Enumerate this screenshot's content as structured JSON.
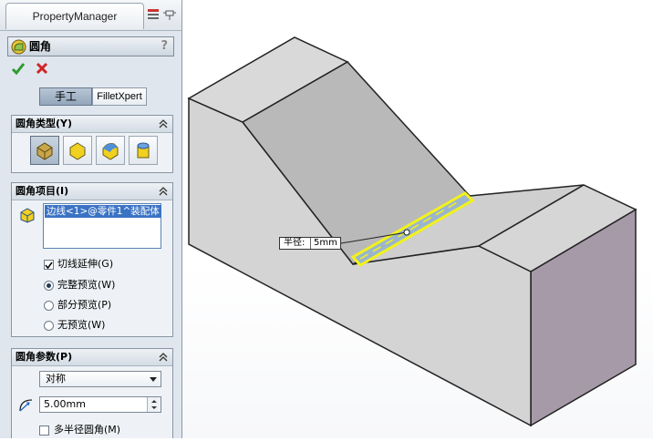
{
  "property_manager": {
    "tab_title": "PropertyManager",
    "feature": {
      "title": "圆角",
      "help": "?"
    },
    "mode_tabs": [
      "手工",
      "FilletXpert"
    ],
    "groups": {
      "fillet_type": {
        "title": "圆角类型(Y)"
      },
      "items": {
        "title": "圆角项目(I)",
        "selected_edge": "边线<1>@零件1^装配体",
        "tangent_propagation": "切线延伸(G)",
        "preview_options": [
          "完整预览(W)",
          "部分预览(P)",
          "无预览(W)"
        ],
        "selected_preview": "完整预览(W)"
      },
      "params": {
        "title": "圆角参数(P)",
        "method": "对称",
        "radius": "5.00mm",
        "multi_radius": "多半径圆角(M)"
      }
    }
  },
  "viewport": {
    "callout_label": "半径:",
    "callout_value": "5mm"
  },
  "colors": {
    "panel_bg": "#dfe6ee",
    "selection_blue": "#3b73c4",
    "highlight_yellow": "#f2f21a",
    "model_face": "#d3d3d3"
  }
}
